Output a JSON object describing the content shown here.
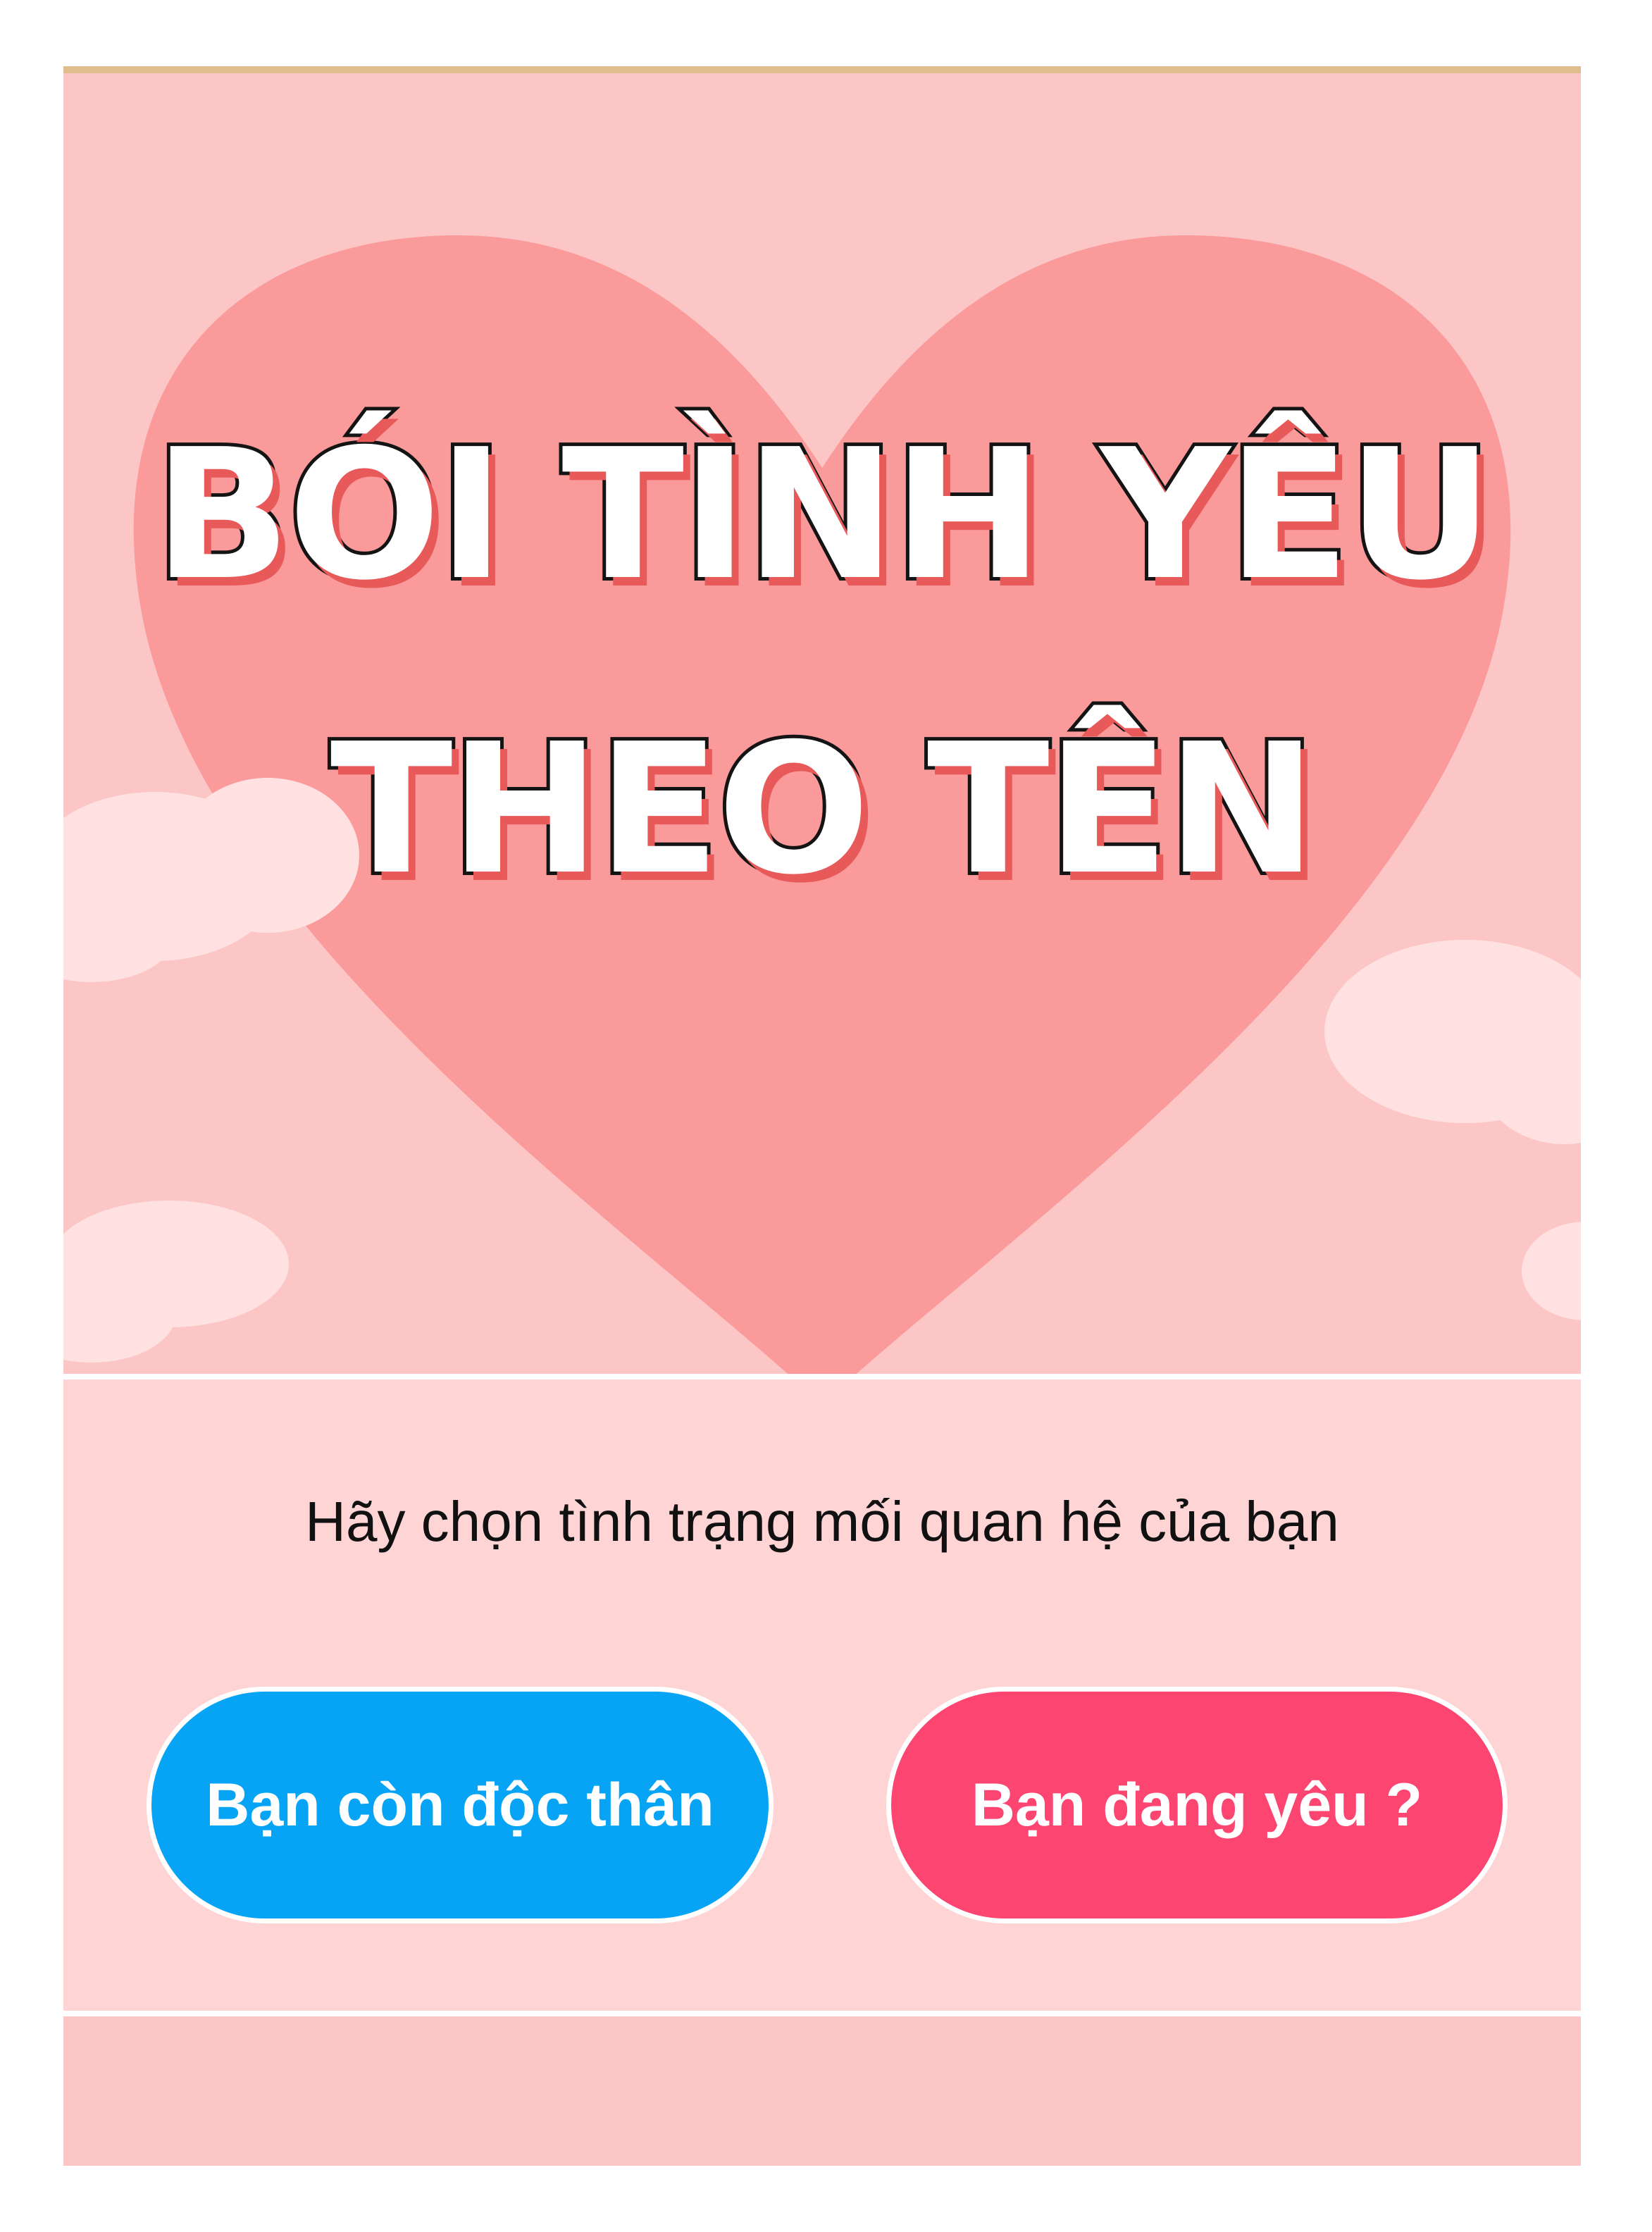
{
  "hero": {
    "title_line1": "BÓI TÌNH YÊU",
    "title_line2": "THEO TÊN",
    "decoration": "heart-icon"
  },
  "prompt": "Hãy chọn tình trạng mối quan hệ của bạn",
  "buttons": {
    "single_label": "Bạn còn độc thân",
    "in_love_label": "Bạn đang yêu ?"
  },
  "colors": {
    "background": "#ffd4d4",
    "hero_background": "#fcc6c6",
    "heart": "#fa9a9a",
    "single_button": "#07a4f6",
    "in_love_button": "#fc4571",
    "title_fill": "#ffffff",
    "title_outline": "#141414",
    "title_shadow": "#e85a5a"
  }
}
